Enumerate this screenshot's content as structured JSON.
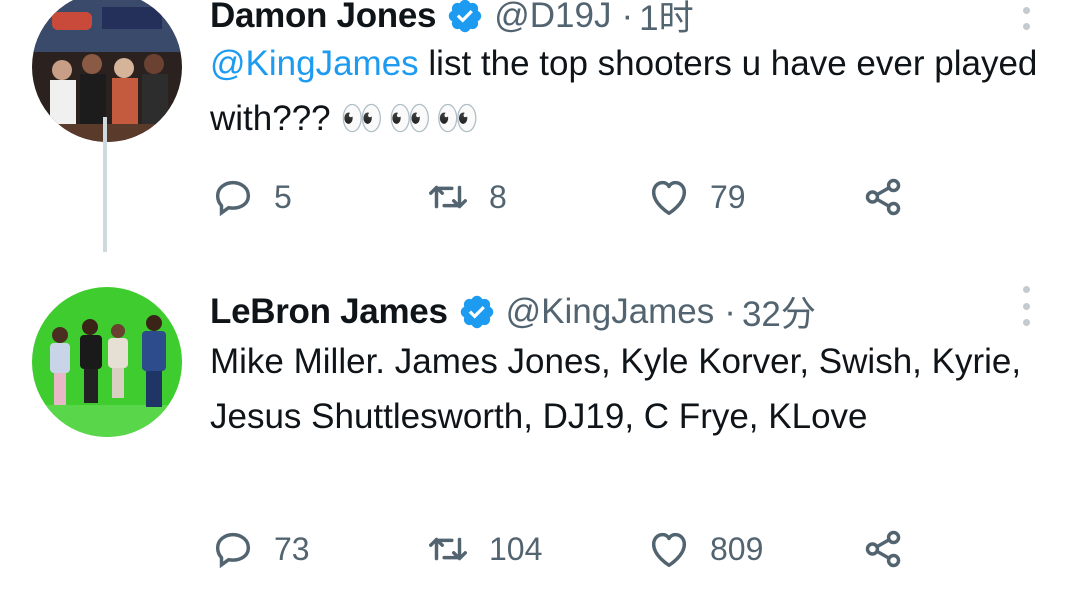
{
  "tweets": [
    {
      "name": "Damon Jones",
      "handle": "@D19J",
      "separator": "·",
      "time": "1时",
      "mention": "@KingJames",
      "text": " list the top shooters u have ever played with??? ",
      "emoji": "👀👀👀",
      "replies": "5",
      "retweets": "8",
      "likes": "79"
    },
    {
      "name": "LeBron James",
      "handle": "@KingJames",
      "separator": "·",
      "time": "32分",
      "text": "Mike Miller. James Jones, Kyle Korver, Swish, Kyrie, Jesus Shuttlesworth, DJ19, C Frye, KLove",
      "replies": "73",
      "retweets": "104",
      "likes": "809"
    }
  ],
  "colors": {
    "verified": "#1d9bf0",
    "mention": "#1d9bf0",
    "muted": "#536471",
    "thread_line": "#cfd9de",
    "avatar1_bg": "#2a2a2a",
    "avatar2_bg": "#3fcc2e"
  },
  "icons": [
    "verified-badge-icon",
    "more-options-icon",
    "reply-icon",
    "retweet-icon",
    "like-icon",
    "share-icon"
  ]
}
